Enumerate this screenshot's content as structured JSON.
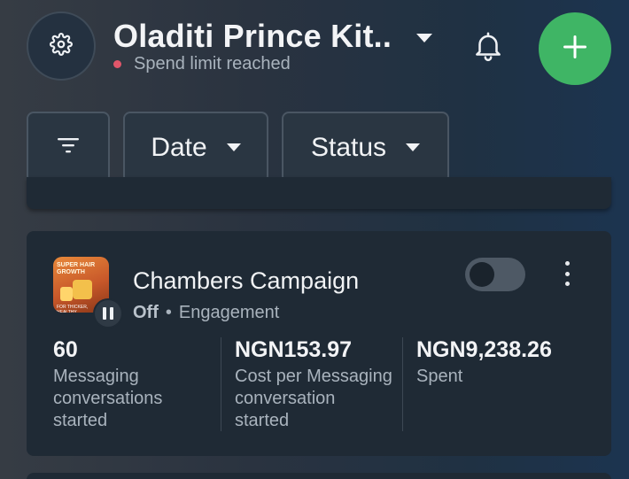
{
  "header": {
    "account_name": "Oladiti Prince Kit..",
    "status_text": "Spend limit reached",
    "status_color": "#e0566a",
    "settings_icon": "gear-icon",
    "notification_icon": "bell-icon",
    "add_icon": "plus-icon",
    "add_color": "#3fb565"
  },
  "filters": {
    "filter_icon": "filter-icon",
    "date_label": "Date",
    "status_label": "Status"
  },
  "campaign": {
    "name": "Chambers Campaign",
    "status": "Off",
    "separator": "•",
    "objective": "Engagement",
    "toggle_on": false,
    "thumbnail": {
      "line1": "SUPER HAIR",
      "line2": "GROWTH",
      "line3": "FOR THICKER, HEALTHY"
    },
    "metrics": [
      {
        "value": "60",
        "label_lines": [
          "Messaging",
          "conversations",
          "started"
        ]
      },
      {
        "value": "NGN153.97",
        "label_lines": [
          "Cost per Messaging",
          "conversation",
          "started"
        ]
      },
      {
        "value": "NGN9,238.26",
        "label_lines": [
          "Spent"
        ]
      }
    ]
  }
}
